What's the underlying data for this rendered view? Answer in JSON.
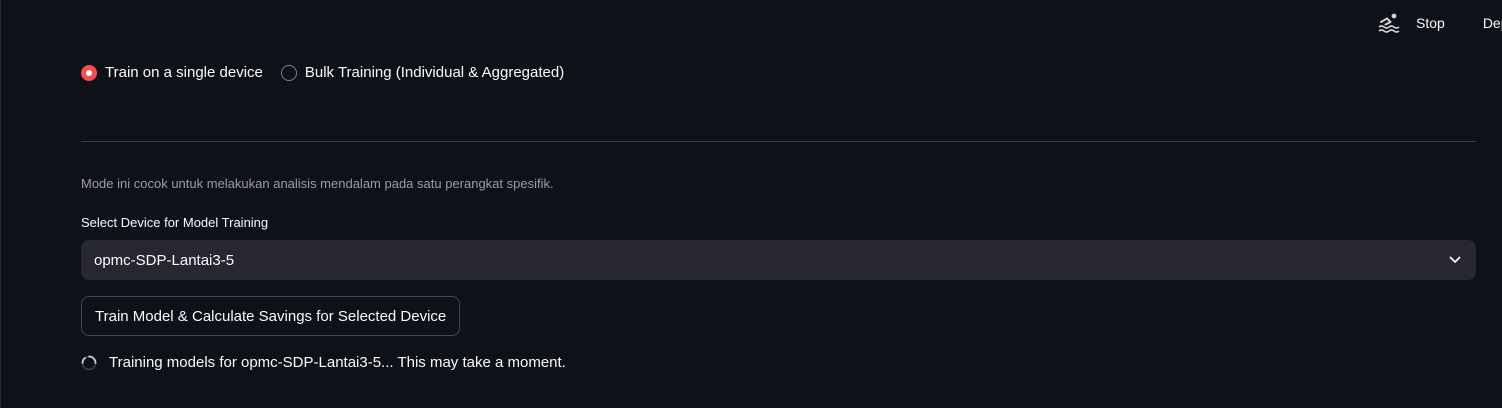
{
  "toolbar": {
    "running_icon": "swimmer-running-icon",
    "stop_label": "Stop",
    "deploy_label": "Deplo"
  },
  "mode_radio": {
    "options": [
      {
        "label": "Train on a single device",
        "selected": true
      },
      {
        "label": "Bulk Training (Individual & Aggregated)",
        "selected": false
      }
    ]
  },
  "caption": "Mode ini cocok untuk melakukan analisis mendalam pada satu perangkat spesifik.",
  "device_select": {
    "label": "Select Device for Model Training",
    "value": "opmc-SDP-Lantai3-5",
    "icon": "chevron-down-icon"
  },
  "train_button": {
    "label": "Train Model & Calculate Savings for Selected Device"
  },
  "status": {
    "icon": "spinner-icon",
    "text": "Training models for opmc-SDP-Lantai3-5... This may take a moment."
  },
  "colors": {
    "background": "#0e1117",
    "accent": "#ff4b4b",
    "input_bg": "#262730",
    "muted_text": "#9a9ca3"
  }
}
